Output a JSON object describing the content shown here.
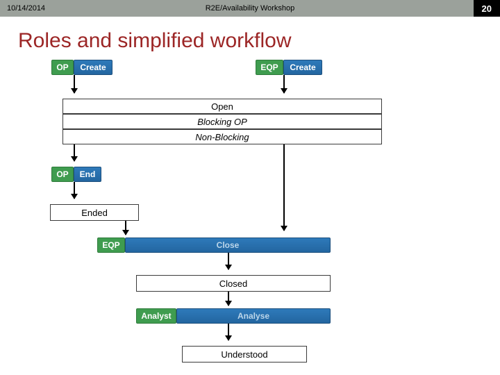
{
  "header": {
    "date": "10/14/2014",
    "course": "R2E/Availability Workshop",
    "slide_number": "20"
  },
  "title": "Roles and simplified workflow",
  "roles": {
    "op1": "OP",
    "eqp1": "EQP",
    "op2": "OP",
    "eqp2": "EQP",
    "analyst": "Analyst"
  },
  "actions": {
    "create1": "Create",
    "create2": "Create",
    "end": "End",
    "close": "Close",
    "analyse": "Analyse"
  },
  "states": {
    "open": "Open",
    "blocking": "Blocking OP",
    "nonblocking": "Non-Blocking",
    "ended": "Ended",
    "closed": "Closed",
    "understood": "Understood"
  }
}
